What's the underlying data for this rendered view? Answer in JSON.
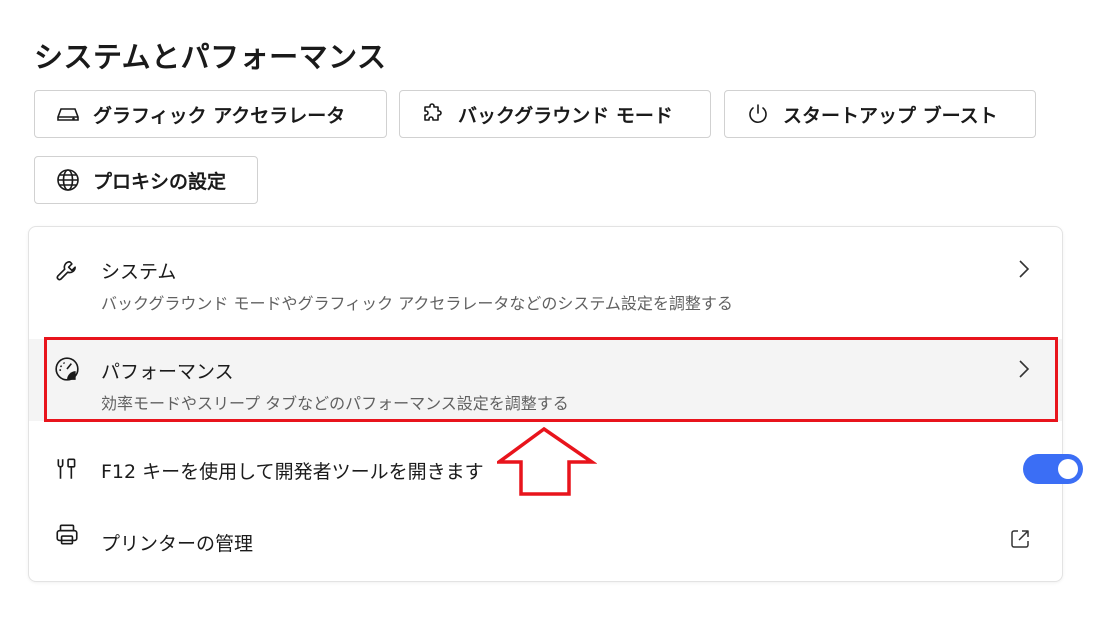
{
  "page": {
    "title": "システムとパフォーマンス"
  },
  "quick_links": [
    {
      "label": "グラフィック アクセラレータ",
      "icon": "drive-icon"
    },
    {
      "label": "バックグラウンド モード",
      "icon": "puzzle-icon"
    },
    {
      "label": "スタートアップ ブースト",
      "icon": "power-icon"
    },
    {
      "label": "プロキシの設定",
      "icon": "globe-icon"
    }
  ],
  "settings": {
    "system": {
      "title": "システム",
      "description": "バックグラウンド モードやグラフィック アクセラレータなどのシステム設定を調整する",
      "icon": "wrench-icon"
    },
    "performance": {
      "title": "パフォーマンス",
      "description": "効率モードやスリープ タブなどのパフォーマンス設定を調整する",
      "icon": "performance-gauge-icon"
    },
    "devtools": {
      "title": "F12 キーを使用して開発者ツールを開きます",
      "icon": "tools-icon",
      "toggle_on": true
    },
    "printers": {
      "title": "プリンターの管理",
      "icon": "printer-icon"
    }
  },
  "colors": {
    "accent": "#3b6ef5",
    "highlight": "#e8141c",
    "hover_row": "#f4f4f4"
  }
}
